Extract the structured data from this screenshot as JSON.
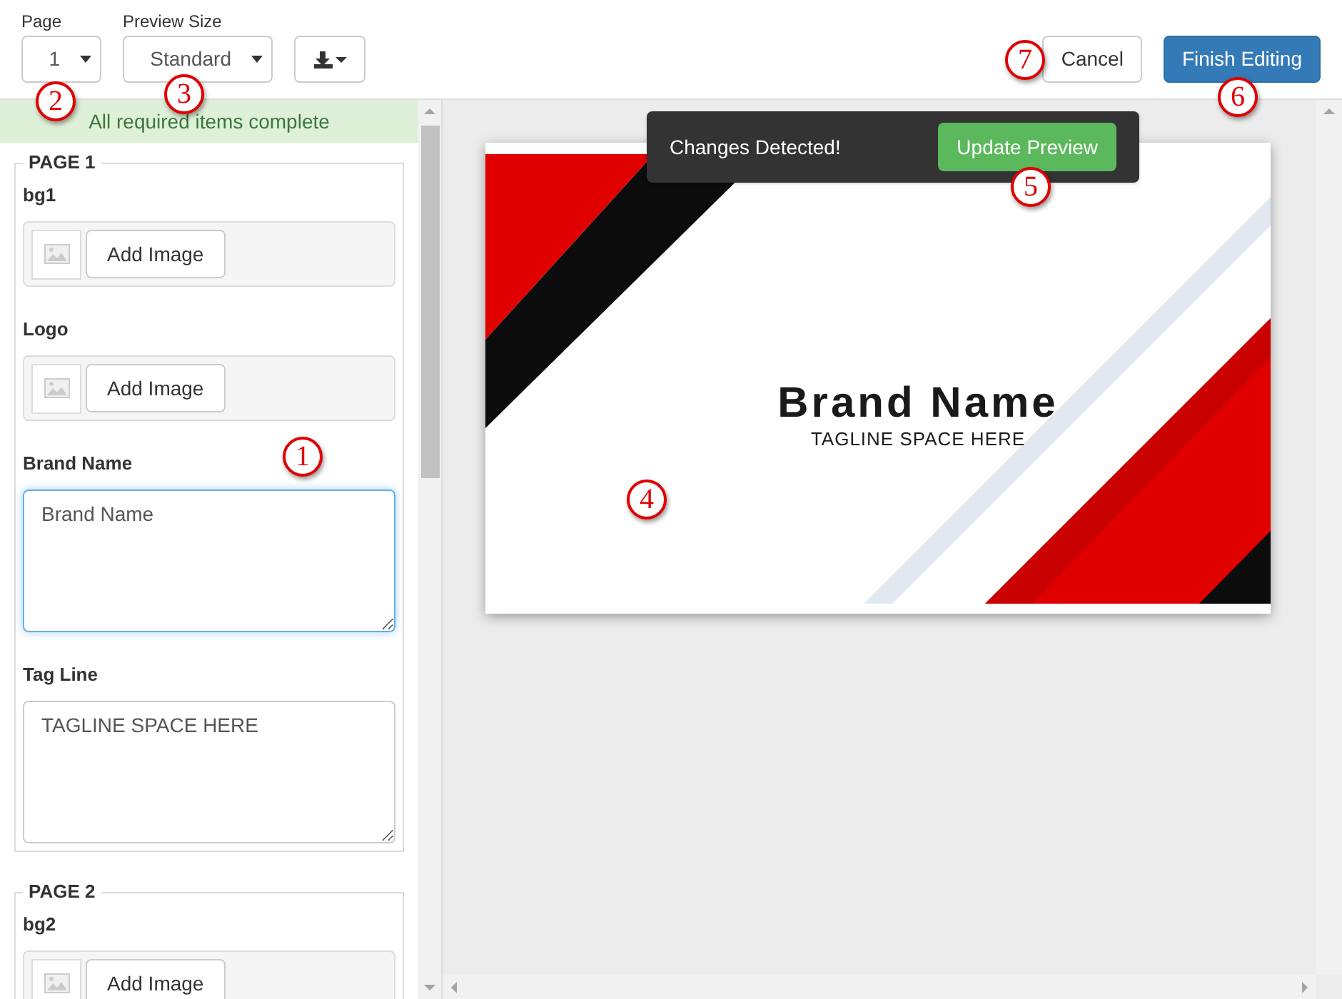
{
  "toolbar": {
    "page": {
      "label": "Page",
      "value": "1"
    },
    "preview_size": {
      "label": "Preview Size",
      "value": "Standard"
    },
    "buttons": [
      {
        "label": "Cancel",
        "kind": "default"
      },
      {
        "label": "Finish Editing",
        "kind": "primary"
      }
    ]
  },
  "status_banner": "All required items complete",
  "sections": [
    {
      "title": "PAGE 1",
      "fields": [
        {
          "kind": "image",
          "label": "bg1",
          "button": "Add Image"
        },
        {
          "kind": "image",
          "label": "Logo",
          "button": "Add Image"
        },
        {
          "kind": "textarea",
          "label": "Brand Name",
          "value": "Brand Name",
          "focused": true
        },
        {
          "kind": "textarea",
          "label": "Tag Line",
          "value": "TAGLINE SPACE HERE",
          "focused": false
        }
      ]
    },
    {
      "title": "PAGE 2",
      "fields": [
        {
          "kind": "image",
          "label": "bg2",
          "button": "Add Image"
        }
      ]
    }
  ],
  "toast": {
    "message": "Changes Detected!",
    "button": "Update Preview"
  },
  "preview": {
    "brand": "Brand Name",
    "tagline": "TAGLINE SPACE HERE"
  },
  "callouts": [
    "1",
    "2",
    "3",
    "4",
    "5",
    "6",
    "7"
  ]
}
